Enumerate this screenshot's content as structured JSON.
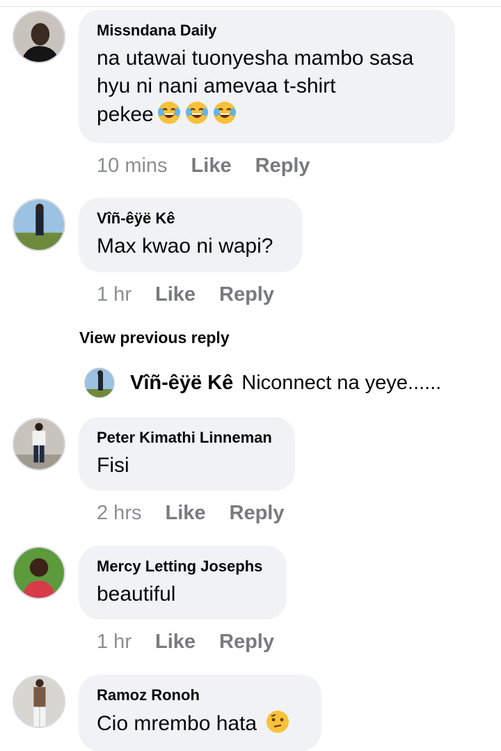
{
  "comments": [
    {
      "author": "Missndana Daily",
      "text_lines": [
        "na utawai tuonyesha mambo sasa",
        "hyu ni nani amevaa t-shirt",
        "pekee"
      ],
      "emojis": [
        "face-with-tears-of-joy-icon",
        "face-with-tears-of-joy-icon",
        "face-with-tears-of-joy-icon"
      ],
      "time": "10 mins",
      "like_label": "Like",
      "reply_label": "Reply"
    },
    {
      "author": "Vîñ-êÿë Kê",
      "text": "Max kwao ni wapi?",
      "time": "1 hr",
      "like_label": "Like",
      "reply_label": "Reply"
    },
    {
      "author": "Peter Kimathi Linneman",
      "text": "Fisi",
      "time": "2 hrs",
      "like_label": "Like",
      "reply_label": "Reply"
    },
    {
      "author": "Mercy Letting Josephs",
      "text": "beautiful",
      "time": "1 hr",
      "like_label": "Like",
      "reply_label": "Reply"
    },
    {
      "author": "Ramoz Ronoh",
      "text": "Cio mrembo hata",
      "emoji": "thinking-face-icon"
    }
  ],
  "view_previous_reply": "View previous reply",
  "reply_preview": {
    "author": "Vîñ-êÿë Kê",
    "text": "Niconnect na yeye......"
  }
}
